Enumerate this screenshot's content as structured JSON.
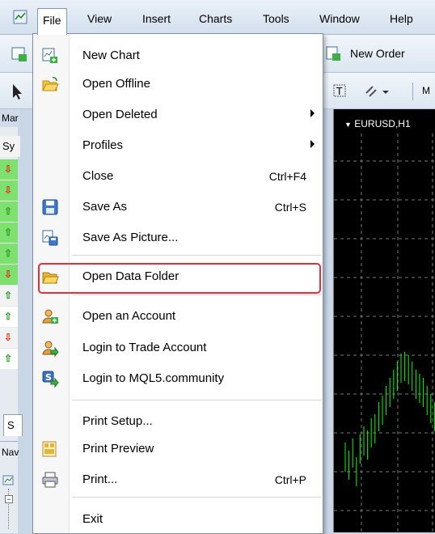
{
  "menubar": [
    "File",
    "View",
    "Insert",
    "Charts",
    "Tools",
    "Window",
    "Help"
  ],
  "toolbar": {
    "new_order_label": "New Order",
    "partial_label": "M"
  },
  "market_watch": {
    "title_partial": "Mar",
    "column_partial": "Sy",
    "tab_partial": "S",
    "arrows": [
      "down",
      "down",
      "up",
      "up",
      "up",
      "down",
      "up",
      "up",
      "down",
      "up"
    ]
  },
  "navigator": {
    "title_partial": "Nav"
  },
  "chart": {
    "tab_label": "EURUSD,H1"
  },
  "file_menu": {
    "items": [
      {
        "label": "New Chart",
        "icon": "new-chart-icon"
      },
      {
        "label": "Open Offline",
        "icon": "open-offline-icon"
      },
      {
        "label": "Open Deleted",
        "submenu": true
      },
      {
        "label": "Profiles",
        "submenu": true
      },
      {
        "label": "Close",
        "shortcut": "Ctrl+F4"
      },
      {
        "label": "Save As",
        "shortcut": "Ctrl+S",
        "icon": "save-icon"
      },
      {
        "label": "Save As Picture...",
        "icon": "save-picture-icon"
      },
      {
        "label": "Open Data Folder",
        "icon": "folder-icon",
        "highlighted": true
      },
      {
        "label": "Open an Account",
        "icon": "account-icon"
      },
      {
        "label": "Login to Trade Account",
        "icon": "login-icon"
      },
      {
        "label": "Login to MQL5.community",
        "icon": "mql5-icon"
      },
      {
        "label": "Print Setup..."
      },
      {
        "label": "Print Preview",
        "icon": "print-preview-icon"
      },
      {
        "label": "Print...",
        "shortcut": "Ctrl+P",
        "icon": "printer-icon"
      },
      {
        "label": "Exit"
      }
    ]
  },
  "colors": {
    "up_arrow": "#2a9a2a",
    "down_arrow": "#e03a1e",
    "highlight_border": "#e0303a",
    "chart_candle": "#00ff00"
  }
}
